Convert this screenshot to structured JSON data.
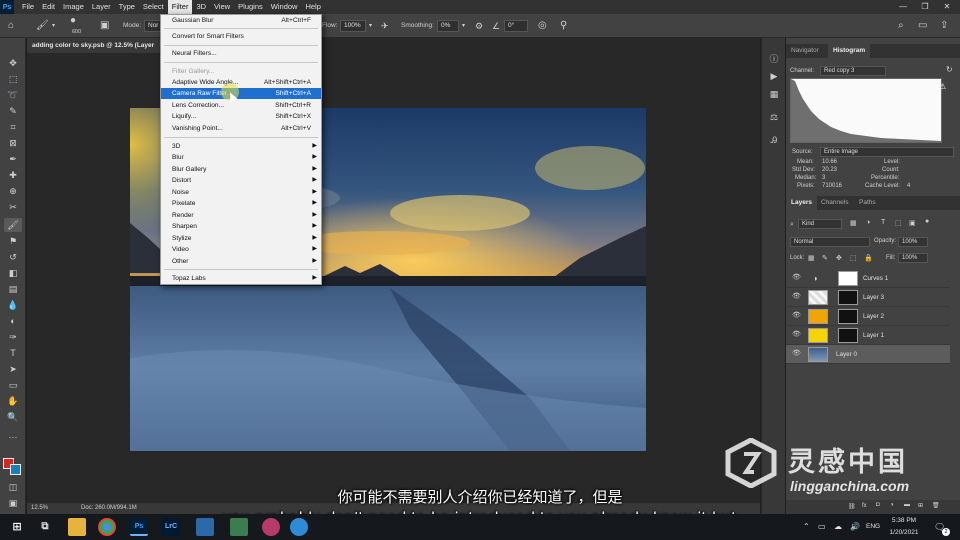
{
  "app": {
    "logo": "Ps",
    "menus": [
      "File",
      "Edit",
      "Image",
      "Layer",
      "Type",
      "Select",
      "Filter",
      "3D",
      "View",
      "Plugins",
      "Window",
      "Help"
    ],
    "active_menu": "Filter"
  },
  "options_bar": {
    "brush_size": "600",
    "mode_label": "Mode:",
    "mode_value": "Nor",
    "flow_label": "Flow:",
    "flow_value": "100%",
    "smoothing_label": "Smoothing:",
    "smoothing_value": "0%",
    "angle_value": "0°"
  },
  "document": {
    "tab_title": "adding color to sky.psb @ 12.5% (Layer",
    "zoom": "12.5%",
    "doc_size": "Doc: 260.0M/994.1M"
  },
  "filter_menu": {
    "items": [
      {
        "label": "Gaussian Blur",
        "shortcut": "Alt+Ctrl+F"
      },
      {
        "label": "Convert for Smart Filters",
        "shortcut": ""
      },
      {
        "label": "Neural Filters...",
        "shortcut": ""
      },
      {
        "label": "Filter Gallery...",
        "shortcut": "",
        "disabled": true
      },
      {
        "label": "Adaptive Wide Angle...",
        "shortcut": "Alt+Shift+Ctrl+A"
      },
      {
        "label": "Camera Raw Filter...",
        "shortcut": "Shift+Ctrl+A",
        "highlighted": true
      },
      {
        "label": "Lens Correction...",
        "shortcut": "Shift+Ctrl+R"
      },
      {
        "label": "Liquify...",
        "shortcut": "Shift+Ctrl+X"
      },
      {
        "label": "Vanishing Point...",
        "shortcut": "Alt+Ctrl+V"
      },
      {
        "label": "3D",
        "submenu": true
      },
      {
        "label": "Blur",
        "submenu": true
      },
      {
        "label": "Blur Gallery",
        "submenu": true
      },
      {
        "label": "Distort",
        "submenu": true
      },
      {
        "label": "Noise",
        "submenu": true
      },
      {
        "label": "Pixelate",
        "submenu": true
      },
      {
        "label": "Render",
        "submenu": true
      },
      {
        "label": "Sharpen",
        "submenu": true
      },
      {
        "label": "Stylize",
        "submenu": true
      },
      {
        "label": "Video",
        "submenu": true
      },
      {
        "label": "Other",
        "submenu": true
      },
      {
        "label": "Topaz Labs",
        "submenu": true
      }
    ]
  },
  "histogram_panel": {
    "tabs": [
      "Navigator",
      "Histogram"
    ],
    "active_tab": "Histogram",
    "channel_label": "Channel:",
    "channel_value": "Red copy 3",
    "source_label": "Source:",
    "source_value": "Entire Image",
    "stats_left": [
      {
        "label": "Mean:",
        "value": "10.66"
      },
      {
        "label": "Std Dev:",
        "value": "20.23"
      },
      {
        "label": "Median:",
        "value": "3"
      },
      {
        "label": "Pixels:",
        "value": "710016"
      }
    ],
    "stats_right": [
      {
        "label": "Level:",
        "value": ""
      },
      {
        "label": "Count:",
        "value": ""
      },
      {
        "label": "Percentile:",
        "value": ""
      },
      {
        "label": "Cache Level:",
        "value": "4"
      }
    ]
  },
  "layers_panel": {
    "tabs": [
      "Layers",
      "Channels",
      "Paths"
    ],
    "active_tab": "Layers",
    "kind_label": "Kind",
    "blend_mode": "Normal",
    "opacity_label": "Opacity:",
    "opacity_value": "100%",
    "lock_label": "Lock:",
    "fill_label": "Fill:",
    "fill_value": "100%",
    "layers": [
      {
        "name": "Curves 1",
        "thumb_color": "#ffffff",
        "selected": false
      },
      {
        "name": "Layer 3",
        "thumb_color": "#e6e6e6",
        "selected": false
      },
      {
        "name": "Layer 2",
        "thumb_color": "#f2a400",
        "selected": false
      },
      {
        "name": "Layer 1",
        "thumb_color": "#f5d400",
        "selected": false
      },
      {
        "name": "Layer 0",
        "thumb_color": "#4d6f96",
        "selected": true
      }
    ]
  },
  "subtitles": {
    "chinese": "你可能不需要别人介绍你已经知道了，但是",
    "english": "you probably don't need to be introduced to you already know it but"
  },
  "watermark": {
    "brand": "灵感中国",
    "url": "lingganchina.com"
  },
  "taskbar": {
    "apps": [
      "Ps",
      "LrC"
    ],
    "language": "ENG",
    "time": "5:38 PM",
    "date": "1/20/2021",
    "notifications": "2"
  }
}
